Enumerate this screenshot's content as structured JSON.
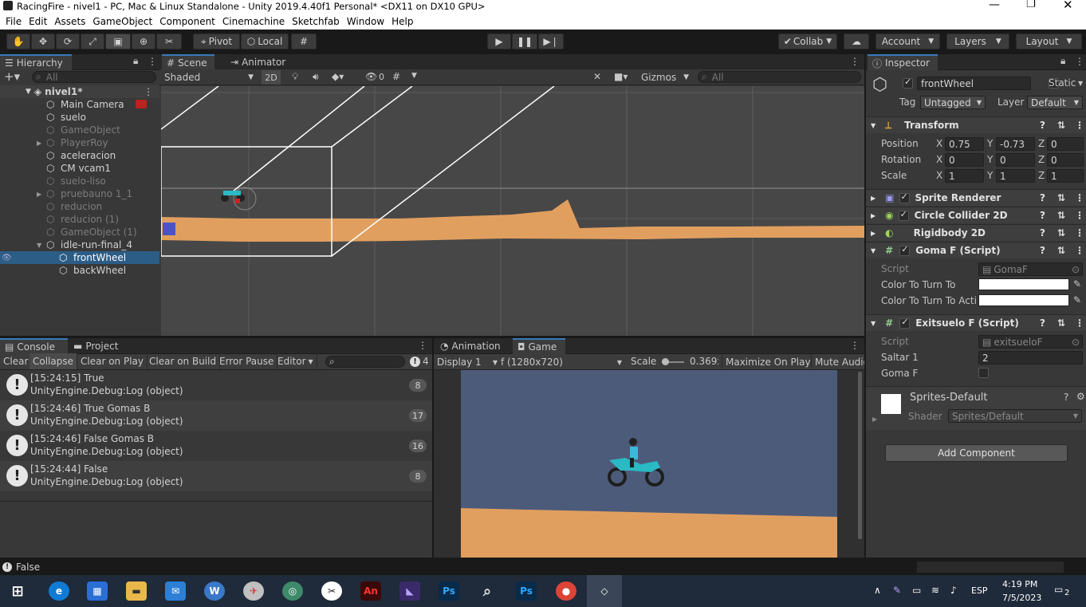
{
  "window": {
    "title": "RacingFire - nivel1 - PC, Mac & Linux Standalone - Unity 2019.4.40f1 Personal* <DX11 on DX10 GPU>"
  },
  "menu": [
    "File",
    "Edit",
    "Assets",
    "GameObject",
    "Component",
    "Cinemachine",
    "Sketchfab",
    "Window",
    "Help"
  ],
  "toolbar": {
    "pivot": "Pivot",
    "local": "Local",
    "collab": "Collab",
    "account": "Account",
    "layers": "Layers",
    "layout": "Layout"
  },
  "hierarchy": {
    "tab": "Hierarchy",
    "search_placeholder": "All",
    "scene": "nivel1*",
    "items": [
      {
        "label": "Main Camera",
        "dim": false,
        "indent": 1
      },
      {
        "label": "suelo",
        "dim": false,
        "indent": 1
      },
      {
        "label": "GameObject",
        "dim": true,
        "indent": 1
      },
      {
        "label": "PlayerRoy",
        "dim": true,
        "indent": 1,
        "foldout": true
      },
      {
        "label": "aceleracion",
        "dim": false,
        "indent": 1
      },
      {
        "label": "CM vcam1",
        "dim": false,
        "indent": 1
      },
      {
        "label": "suelo-liso",
        "dim": true,
        "indent": 1
      },
      {
        "label": "pruebauno 1_1",
        "dim": true,
        "indent": 1,
        "foldout": true
      },
      {
        "label": "reducion",
        "dim": true,
        "indent": 1
      },
      {
        "label": "reducion (1)",
        "dim": true,
        "indent": 1
      },
      {
        "label": "GameObject (1)",
        "dim": true,
        "indent": 1
      },
      {
        "label": "idle-run-final_4",
        "dim": false,
        "indent": 1,
        "foldout": true,
        "open": true
      },
      {
        "label": "frontWheel",
        "dim": false,
        "indent": 2,
        "selected": true
      },
      {
        "label": "backWheel",
        "dim": false,
        "indent": 2
      }
    ]
  },
  "scene": {
    "tabs": [
      "Scene",
      "Animator"
    ],
    "shading": "Shaded",
    "mode2d": "2D",
    "hidden_count": "0",
    "gizmos": "Gizmos",
    "search_placeholder": "All"
  },
  "inspector": {
    "tab": "Inspector",
    "object_name": "frontWheel",
    "static_label": "Static",
    "tag_label": "Tag",
    "tag": "Untagged",
    "layer_label": "Layer",
    "layer": "Default",
    "transform": {
      "title": "Transform",
      "position_label": "Position",
      "rotation_label": "Rotation",
      "scale_label": "Scale",
      "position": [
        "0.75",
        "-0.73",
        "0"
      ],
      "rotation": [
        "0",
        "0",
        "0"
      ],
      "scale": [
        "1",
        "1",
        "1"
      ]
    },
    "components": [
      "Sprite Renderer",
      "Circle Collider 2D",
      "Rigidbody 2D"
    ],
    "goma": {
      "title": "Goma F (Script)",
      "script_label": "Script",
      "script": "GomaF",
      "color1_label": "Color To Turn To",
      "color2_label": "Color To Turn To Acti"
    },
    "exit": {
      "title": "Exitsuelo F (Script)",
      "script_label": "Script",
      "script": "exitsueloF",
      "saltar_label": "Saltar 1",
      "saltar": "2",
      "goma_label": "Goma F"
    },
    "material": {
      "name": "Sprites-Default",
      "shader_label": "Shader",
      "shader": "Sprites/Default"
    },
    "add_component": "Add Component"
  },
  "console": {
    "tabs": [
      "Console",
      "Project"
    ],
    "buttons": [
      "Clear",
      "Collapse",
      "Clear on Play",
      "Clear on Build",
      "Error Pause",
      "Editor"
    ],
    "count": "4",
    "entries": [
      {
        "line1": "[15:24:15] True",
        "line2": "UnityEngine.Debug:Log (object)",
        "count": "8"
      },
      {
        "line1": "[15:24:46] True Gomas B",
        "line2": "UnityEngine.Debug:Log (object)",
        "count": "17"
      },
      {
        "line1": "[15:24:46] False Gomas B",
        "line2": "UnityEngine.Debug:Log (object)",
        "count": "16"
      },
      {
        "line1": "[15:24:44] False",
        "line2": "UnityEngine.Debug:Log (object)",
        "count": "8"
      }
    ]
  },
  "game": {
    "tabs": [
      "Animation",
      "Game"
    ],
    "display": "Display 1",
    "resolution": "f (1280x720)",
    "scale_label": "Scale",
    "scale": "0.369x",
    "maximize": "Maximize On Play",
    "mute": "Mute Audio"
  },
  "status": {
    "text": "False"
  },
  "taskbar": {
    "lang": "ESP",
    "time": "4:19 PM",
    "date": "7/5/2023",
    "notifications": "2"
  },
  "colors": {
    "ground": "#e19f5f",
    "sky": "#4d5b7a",
    "selection": "#2c5d87",
    "accent": "#3a79bb"
  }
}
